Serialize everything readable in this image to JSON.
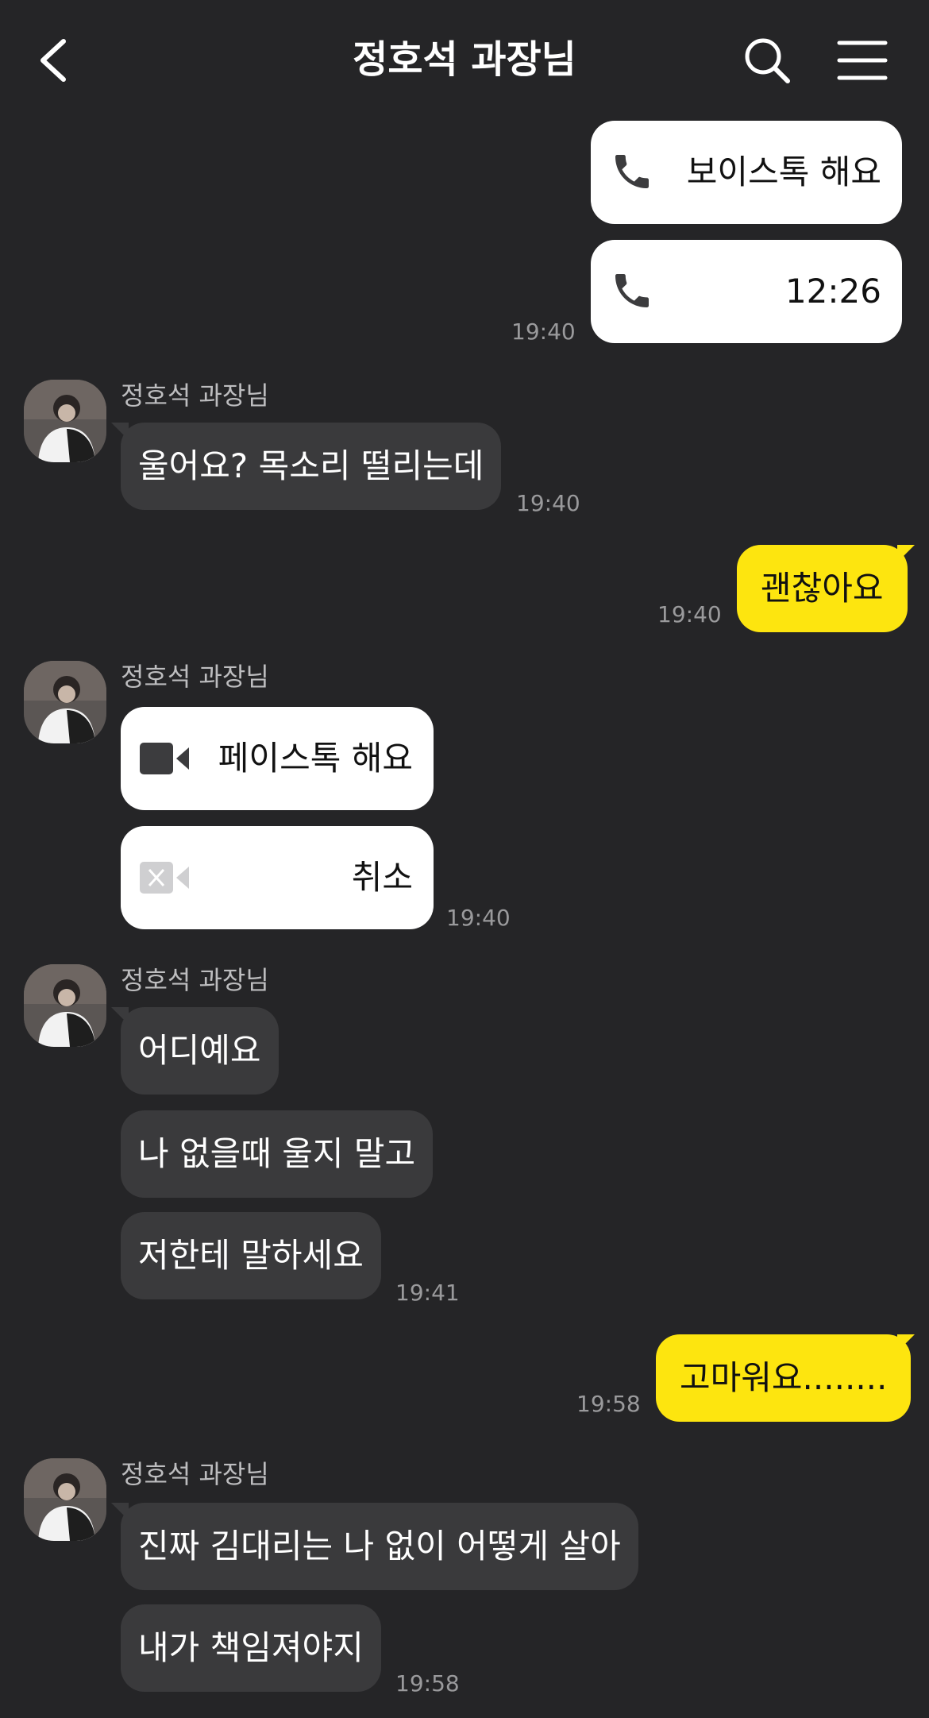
{
  "header": {
    "title": "정호석 과장님",
    "back_icon": "chevron-left-icon",
    "search_icon": "search-icon",
    "menu_icon": "hamburger-menu-icon"
  },
  "colors": {
    "background": "#252527",
    "received_bubble": "#3a3a3c",
    "sent_bubble": "#fde50f",
    "call_card": "#ffffff",
    "timestamp": "#9a9a9c"
  },
  "messages": {
    "m1_voice_call": {
      "label": "보이스톡 해요",
      "icon": "phone-icon"
    },
    "m2_voice_call_duration": {
      "label": "12:26",
      "icon": "phone-icon",
      "time": "19:40"
    },
    "m3": {
      "sender": "정호석 과장님",
      "text": "울어요? 목소리 떨리는데",
      "time": "19:40"
    },
    "m4": {
      "text": "괜찮아요",
      "time": "19:40"
    },
    "m5_facetalk": {
      "sender": "정호석 과장님",
      "label": "페이스톡 해요",
      "icon": "video-camera-icon"
    },
    "m6_facetalk_cancel": {
      "label": "취소",
      "icon": "video-camera-off-icon",
      "time": "19:40"
    },
    "m7": {
      "sender": "정호석 과장님",
      "text": "어디예요"
    },
    "m8": {
      "text": "나 없을때 울지 말고"
    },
    "m9": {
      "text": "저한테 말하세요",
      "time": "19:41"
    },
    "m10": {
      "text": "고마워요........",
      "time": "19:58"
    },
    "m11": {
      "sender": "정호석 과장님",
      "text": "진짜 김대리는 나 없이 어떻게 살아"
    },
    "m12": {
      "text": "내가 책임져야지",
      "time": "19:58"
    }
  }
}
